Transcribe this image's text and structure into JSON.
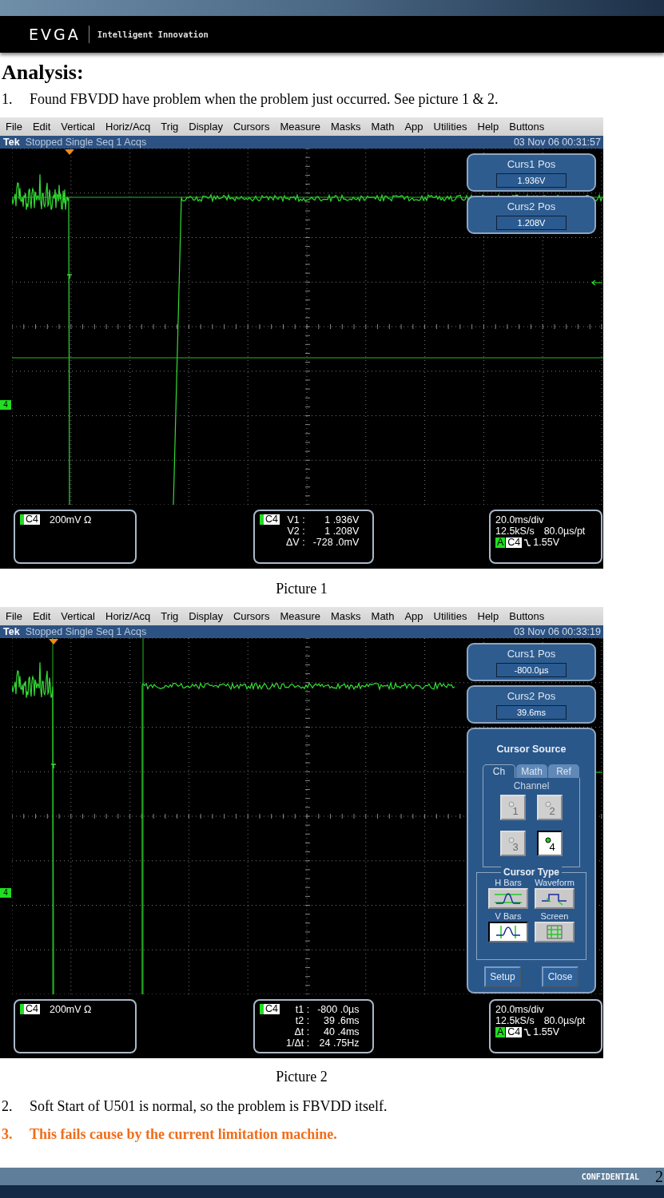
{
  "header": {
    "logo": "EVGA",
    "tagline": "Intelligent Innovation"
  },
  "heading": "Analysis:",
  "items_before": [
    {
      "number": "1.",
      "text": "Found FBVDD have problem when the problem just occurred. See picture 1 & 2.",
      "emphasis": false
    }
  ],
  "figures": [
    {
      "menu": [
        "File",
        "Edit",
        "Vertical",
        "Horiz/Acq",
        "Trig",
        "Display",
        "Cursors",
        "Measure",
        "Masks",
        "Math",
        "App",
        "Utilities",
        "Help",
        "Buttons"
      ],
      "status": {
        "brand": "Tek",
        "state": "Stopped Single Seq 1 Acqs",
        "datetime": "03 Nov 06 00:31:57"
      },
      "channel_marker": "4",
      "cursors": {
        "kind": "h_bars"
      },
      "cursor_boxes": [
        {
          "label": "Curs1 Pos",
          "value": "1.936V"
        },
        {
          "label": "Curs2 Pos",
          "value": "1.208V"
        }
      ],
      "info": {
        "channel": {
          "tag": "C4",
          "scale": "200mV Ω"
        },
        "readouts": {
          "tag": "C4",
          "rows": [
            {
              "label": "V1 :",
              "value": "1 .936V"
            },
            {
              "label": "V2 :",
              "value": "1 .208V"
            },
            {
              "label": "ΔV :",
              "value": "-728 .0mV"
            }
          ]
        },
        "timebase": {
          "scale": "20.0ms/div",
          "rate": "12.5kS/s",
          "resolution": "80.0µs/pt",
          "mode": "A",
          "source": "C4",
          "level": "1.55V"
        }
      },
      "caption": "Picture 1"
    },
    {
      "menu": [
        "File",
        "Edit",
        "Vertical",
        "Horiz/Acq",
        "Trig",
        "Display",
        "Cursors",
        "Measure",
        "Masks",
        "Math",
        "App",
        "Utilities",
        "Help",
        "Buttons"
      ],
      "status": {
        "brand": "Tek",
        "state": "Stopped Single Seq 1 Acqs",
        "datetime": "03 Nov 06 00:33:19"
      },
      "channel_marker": "4",
      "cursors": {
        "kind": "v_bars"
      },
      "cursor_boxes": [
        {
          "label": "Curs1 Pos",
          "value": "-800.0µs"
        },
        {
          "label": "Curs2 Pos",
          "value": "39.6ms"
        }
      ],
      "panel": {
        "title": "Cursor Source",
        "tabs": [
          {
            "label": "Ch",
            "selected": true
          },
          {
            "label": "Math",
            "selected": false
          },
          {
            "label": "Ref",
            "selected": false
          }
        ],
        "group_label": "Channel",
        "channels": [
          {
            "label": "1",
            "selected": false,
            "disabled": true
          },
          {
            "label": "2",
            "selected": false,
            "disabled": true
          },
          {
            "label": "3",
            "selected": false,
            "disabled": true
          },
          {
            "label": "4",
            "selected": true,
            "disabled": false
          }
        ],
        "type_label": "Cursor Type",
        "types": [
          {
            "label": "H Bars",
            "kind": "h_bars",
            "selected": false
          },
          {
            "label": "Waveform",
            "kind": "waveform",
            "selected": false
          },
          {
            "label": "V Bars",
            "kind": "v_bars",
            "selected": true
          },
          {
            "label": "Screen",
            "kind": "screen",
            "selected": false
          }
        ],
        "buttons": [
          "Setup",
          "Close"
        ]
      },
      "info": {
        "channel": {
          "tag": "C4",
          "scale": "200mV Ω"
        },
        "readouts": {
          "tag": "C4",
          "rows": [
            {
              "label": "t1 :",
              "value": "-800 .0µs"
            },
            {
              "label": "t2 :",
              "value": "39 .6ms"
            },
            {
              "label": "Δt :",
              "value": "40 .4ms"
            },
            {
              "label": "1/Δt :",
              "value": "24 .75Hz"
            }
          ]
        },
        "timebase": {
          "scale": "20.0ms/div",
          "rate": "12.5kS/s",
          "resolution": "80.0µs/pt",
          "mode": "A",
          "source": "C4",
          "level": "1.55V"
        }
      },
      "caption": "Picture 2"
    }
  ],
  "items_after": [
    {
      "number": "2.",
      "text": "Soft Start of U501 is normal, so the problem is FBVDD itself.",
      "emphasis": false
    },
    {
      "number": "3.",
      "text": "This fails cause by the current limitation machine.",
      "emphasis": true
    }
  ],
  "footer": {
    "label": "CONFIDENTIAL",
    "page": "2"
  }
}
